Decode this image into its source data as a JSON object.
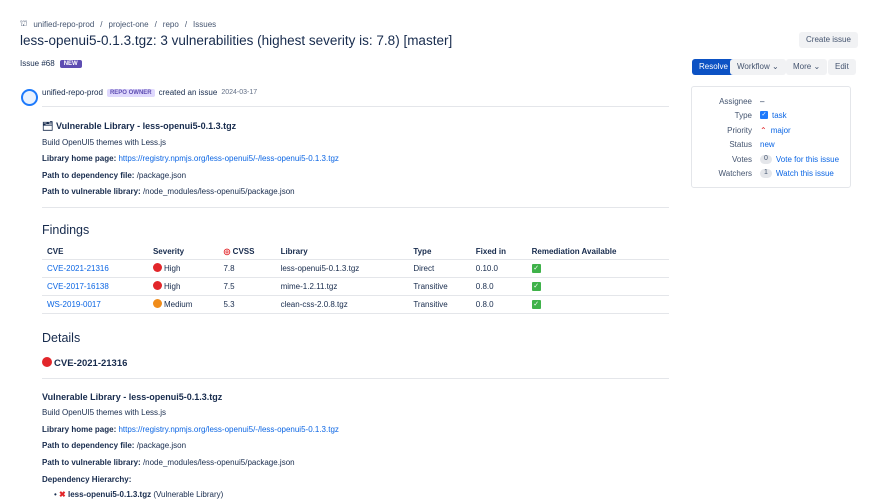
{
  "breadcrumbs": [
    "unified-repo-prod",
    "project-one",
    "repo",
    "Issues"
  ],
  "title": "less-openui5-0.1.3.tgz: 3 vulnerabilities (highest severity is: 7.8) [master]",
  "issue": {
    "number": "Issue #68",
    "badge": "NEW"
  },
  "buttons": {
    "create": "Create issue",
    "resolve": "Resolve",
    "workflow": "Workflow",
    "more": "More",
    "edit": "Edit"
  },
  "panel": {
    "assignee_label": "Assignee",
    "assignee": "–",
    "type_label": "Type",
    "type": "task",
    "priority_label": "Priority",
    "priority": "major",
    "status_label": "Status",
    "status": "new",
    "votes_label": "Votes",
    "votes": "0",
    "vote_link": "Vote for this issue",
    "watchers_label": "Watchers",
    "watchers": "1",
    "watch_link": "Watch this issue"
  },
  "activity": {
    "author": "unified-repo-prod",
    "role": "REPO OWNER",
    "action": "created an issue",
    "date": "2024-03-17"
  },
  "summary": {
    "heading": "Vulnerable Library - less-openui5-0.1.3.tgz",
    "desc": "Build OpenUI5 themes with Less.js",
    "home_label": "Library home page:",
    "home_url": "https://registry.npmjs.org/less-openui5/-/less-openui5-0.1.3.tgz",
    "dep_label": "Path to dependency file:",
    "dep": "/package.json",
    "vuln_label": "Path to vulnerable library:",
    "vuln": "/node_modules/less-openui5/package.json"
  },
  "findings": {
    "heading": "Findings",
    "headers": [
      "CVE",
      "Severity",
      "CVSS",
      "Library",
      "Type",
      "Fixed in",
      "Remediation Available"
    ],
    "rows": [
      {
        "cve": "CVE-2021-21316",
        "severity": "High",
        "color": "#e2262a",
        "cvss": "7.8",
        "library": "less-openui5-0.1.3.tgz",
        "type": "Direct",
        "fixed": "0.10.0"
      },
      {
        "cve": "CVE-2017-16138",
        "severity": "High",
        "color": "#e2262a",
        "cvss": "7.5",
        "library": "mime-1.2.11.tgz",
        "type": "Transitive",
        "fixed": "0.8.0"
      },
      {
        "cve": "WS-2019-0017",
        "severity": "Medium",
        "color": "#f08c1a",
        "cvss": "5.3",
        "library": "clean-css-2.0.8.tgz",
        "type": "Transitive",
        "fixed": "0.8.0"
      }
    ]
  },
  "details": {
    "heading": "Details",
    "cve": "CVE-2021-21316",
    "lib_heading": "Vulnerable Library - less-openui5-0.1.3.tgz",
    "desc": "Build OpenUI5 themes with Less.js",
    "home_label": "Library home page:",
    "home_url": "https://registry.npmjs.org/less-openui5/-/less-openui5-0.1.3.tgz",
    "dep_label": "Path to dependency file:",
    "dep": "/package.json",
    "vuln_label": "Path to vulnerable library:",
    "vuln": "/node_modules/less-openui5/package.json",
    "hier_label": "Dependency Hierarchy:",
    "hier_item": "less-openui5-0.1.3.tgz",
    "hier_note": "(Vulnerable Library)"
  }
}
